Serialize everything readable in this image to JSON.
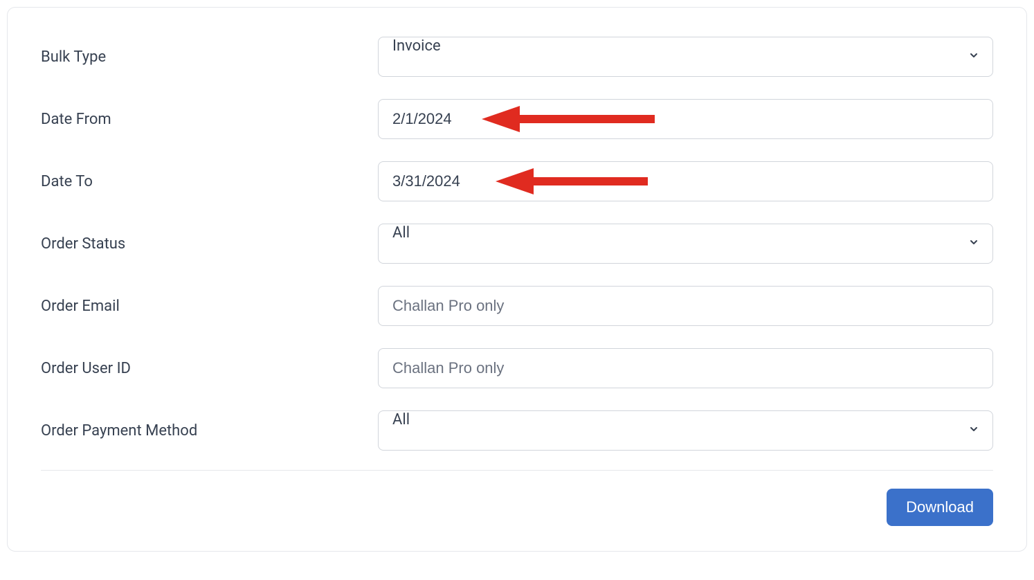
{
  "form": {
    "bulk_type": {
      "label": "Bulk Type",
      "value": "Invoice"
    },
    "date_from": {
      "label": "Date From",
      "value": "2/1/2024"
    },
    "date_to": {
      "label": "Date To",
      "value": "3/31/2024"
    },
    "order_status": {
      "label": "Order Status",
      "value": "All"
    },
    "order_email": {
      "label": "Order Email",
      "value": "",
      "placeholder": "Challan Pro only"
    },
    "order_user_id": {
      "label": "Order User ID",
      "value": "",
      "placeholder": "Challan Pro only"
    },
    "order_payment_method": {
      "label": "Order Payment Method",
      "value": "All"
    }
  },
  "buttons": {
    "download": "Download"
  },
  "colors": {
    "arrow": "#e02b20",
    "primary": "#3b71ca"
  }
}
